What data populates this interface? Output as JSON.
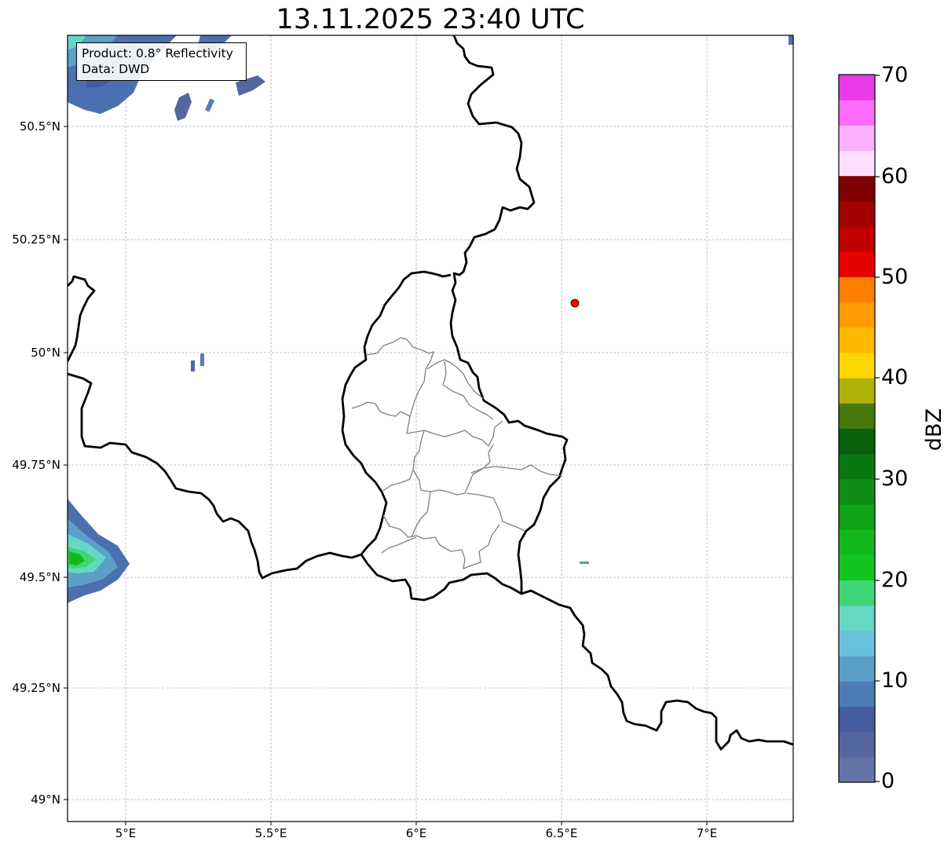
{
  "title": "13.11.2025 23:40 UTC",
  "info": {
    "product": "Product: 0.8° Reflectivity",
    "data_source": "Data: DWD"
  },
  "axes": {
    "lat_labels": [
      "50.5°N",
      "50.25°N",
      "50°N",
      "49.75°N",
      "49.5°N",
      "49.25°N",
      "49°N"
    ],
    "lon_labels": [
      "5°E",
      "5.5°E",
      "6°E",
      "6.5°E",
      "7°E"
    ]
  },
  "colorbar": {
    "label": "dBZ",
    "tick_labels": [
      "0",
      "10",
      "20",
      "30",
      "40",
      "50",
      "60",
      "70"
    ],
    "colors": [
      "#6574a8",
      "#5467a1",
      "#445d9f",
      "#4c7cb3",
      "#5ba0c8",
      "#68c1dc",
      "#65d8c4",
      "#3fd674",
      "#12c61f",
      "#13b81c",
      "#11a318",
      "#0e8d14",
      "#0b7710",
      "#08600c",
      "#47780c",
      "#adb108",
      "#fdd500",
      "#fdb800",
      "#fd9b00",
      "#fd7e00",
      "#e60000",
      "#c00000",
      "#a30000",
      "#7e0000",
      "#fddefd",
      "#fdb0fd",
      "#fd6bfd",
      "#e83be8"
    ]
  },
  "colors": {
    "border": "#000000",
    "admin_border": "#808080",
    "grid": "#b0b0b0",
    "marker": "#ff0000"
  }
}
